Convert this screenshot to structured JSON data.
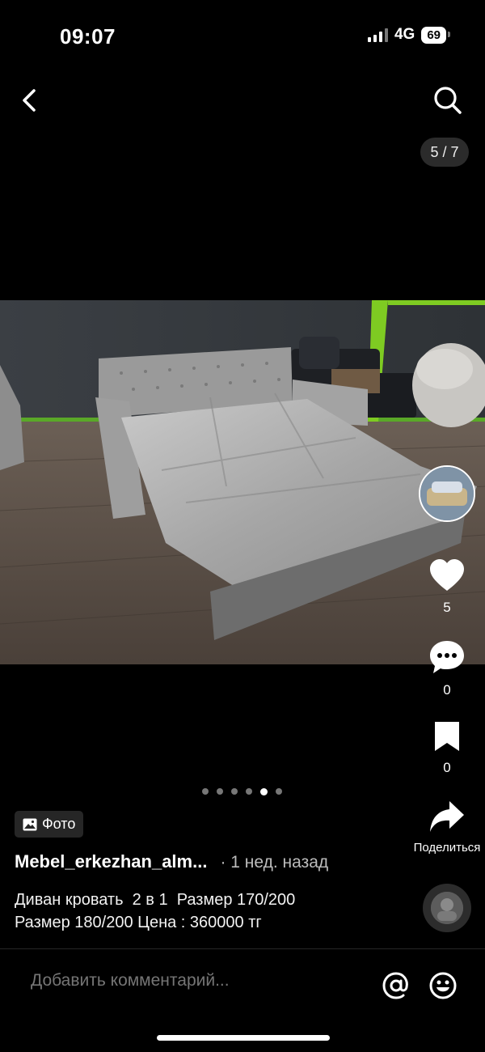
{
  "status_bar": {
    "time": "09:07",
    "network": "4G",
    "battery": "69"
  },
  "nav": {
    "back_icon": "chevron-left-icon",
    "search_icon": "search-icon",
    "counter": "5 / 7"
  },
  "actions": {
    "likes": "5",
    "comments": "0",
    "saves": "0",
    "share_label": "Поделиться"
  },
  "pagination": {
    "total": 6,
    "active": 4
  },
  "post": {
    "badge": "Фото",
    "author": "Mebel_erkezhan_alm...",
    "time_ago": "· 1 нед. назад",
    "description": "Диван кровать  2 в 1  Размер 170/200\nРазмер 180/200 Цена : 360000 тг"
  },
  "composer": {
    "placeholder": "Добавить комментарий..."
  },
  "colors": {
    "background": "#000000",
    "accent_green": "#7ecb22"
  }
}
